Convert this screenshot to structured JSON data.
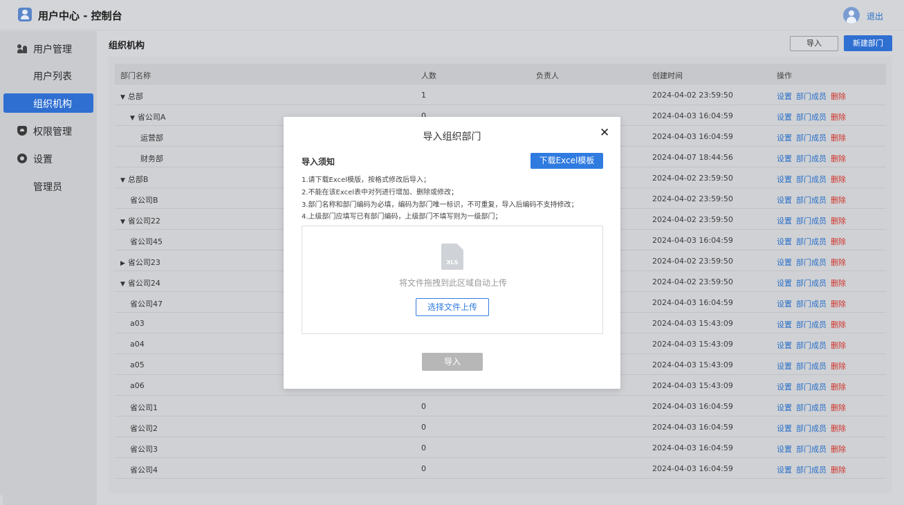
{
  "app": {
    "title": "用户中心 - 控制台",
    "logout": "退出"
  },
  "sidebar": {
    "items": [
      {
        "label": "用户管理",
        "icon": "users-icon"
      },
      {
        "label": "用户列表"
      },
      {
        "label": "组织机构",
        "active": true
      },
      {
        "label": "权限管理",
        "icon": "shield-icon"
      },
      {
        "label": "设置",
        "icon": "gear-icon"
      },
      {
        "label": "管理员"
      }
    ]
  },
  "page": {
    "title": "组织机构",
    "import_label": "导入",
    "new_dept_label": "新建部门"
  },
  "table": {
    "headers": {
      "name": "部门名称",
      "count": "人数",
      "owner": "负责人",
      "created": "创建时间",
      "ops": "操作"
    },
    "ops": {
      "settings": "设置",
      "members": "部门成员",
      "delete": "删除"
    },
    "rows": [
      {
        "name": "总部",
        "tree": "▼",
        "count": "1",
        "created": "2024-04-02 23:59:50"
      },
      {
        "name": "省公司A",
        "tree": "▼",
        "count": "0",
        "created": "2024-04-03 16:04:59"
      },
      {
        "name": "运营部",
        "tree": "",
        "count": "",
        "created": "2024-04-03 16:04:59"
      },
      {
        "name": "财务部",
        "tree": "",
        "count": "",
        "created": "2024-04-07 18:44:56"
      },
      {
        "name": "总部B",
        "tree": "▼",
        "count": "",
        "created": "2024-04-02 23:59:50"
      },
      {
        "name": "省公司B",
        "tree": "",
        "count": "",
        "created": "2024-04-02 23:59:50"
      },
      {
        "name": "省公司22",
        "tree": "▼",
        "count": "",
        "created": "2024-04-02 23:59:50"
      },
      {
        "name": "省公司45",
        "tree": "",
        "count": "",
        "created": "2024-04-03 16:04:59"
      },
      {
        "name": "省公司23",
        "tree": "▶",
        "count": "",
        "created": "2024-04-02 23:59:50"
      },
      {
        "name": "省公司24",
        "tree": "▼",
        "count": "",
        "created": "2024-04-02 23:59:50"
      },
      {
        "name": "省公司47",
        "tree": "",
        "count": "",
        "created": "2024-04-03 16:04:59"
      },
      {
        "name": "a03",
        "tree": "",
        "count": "",
        "created": "2024-04-03 15:43:09"
      },
      {
        "name": "a04",
        "tree": "",
        "count": "",
        "created": "2024-04-03 15:43:09"
      },
      {
        "name": "a05",
        "tree": "",
        "count": "",
        "created": "2024-04-03 15:43:09"
      },
      {
        "name": "a06",
        "tree": "",
        "count": "",
        "created": "2024-04-03 15:43:09"
      },
      {
        "name": "省公司1",
        "tree": "",
        "count": "0",
        "created": "2024-04-03 16:04:59"
      },
      {
        "name": "省公司2",
        "tree": "",
        "count": "0",
        "created": "2024-04-03 16:04:59"
      },
      {
        "name": "省公司3",
        "tree": "",
        "count": "0",
        "created": "2024-04-03 16:04:59"
      },
      {
        "name": "省公司4",
        "tree": "",
        "count": "0",
        "created": "2024-04-03 16:04:59"
      }
    ]
  },
  "modal": {
    "title": "导入组织部门",
    "close": "✕",
    "notice_title": "导入须知",
    "download_label": "下载Excel模板",
    "rules": [
      "1.请下载Excel模版，按格式修改后导入；",
      "2.不能在该Excel表中对列进行增加、删除或修改；",
      "3.部门名称和部门编码为必填，编码为部门唯一标识，不可重复，导入后编码不支持修改；",
      "4.上级部门应填写已有部门编码，上级部门不填写则为一级部门；"
    ],
    "file_icon_label": "XLS",
    "drop_hint": "将文件拖拽到此区域自动上传",
    "select_label": "选择文件上传",
    "import_label": "导入"
  },
  "colors": {
    "primary": "#2f6fd1",
    "danger": "#d0342c",
    "link": "#2a6fc9"
  }
}
